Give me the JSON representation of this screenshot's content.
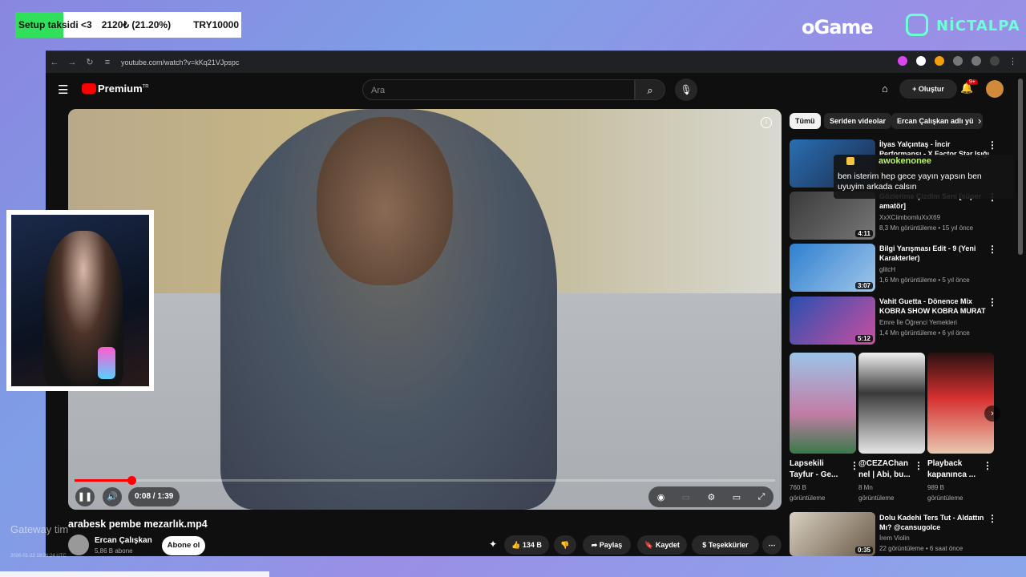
{
  "overlay": {
    "goal_title": "Setup taksidi <3",
    "goal_amount": "2120₺ (21.20%)",
    "goal_target": "TRY10000",
    "goal_progress": 0.212,
    "brand_left": "oGame",
    "brand_right": "NİCTALPA",
    "gateway_text": "Gateway tim",
    "gateway_date": "2026-01-22 18:26:24 UTC"
  },
  "browser": {
    "url": "youtube.com/watch?v=kKq21VJpspc"
  },
  "youtube": {
    "logo": "Premium",
    "logo_sup": "TR",
    "search_placeholder": "Ara",
    "create_label": "Oluştur",
    "notif_badge": "9+"
  },
  "player": {
    "time": "0:08 / 1:39",
    "progress": 0.081
  },
  "video": {
    "title": "arabesk pembe mezarlık.mp4",
    "channel": "Ercan Çalışkan",
    "subscribers": "5,86 B abone",
    "subscribe_label": "Abone ol",
    "likes": "134 B",
    "share_label": "Paylaş",
    "save_label": "Kaydet",
    "thanks_label": "Teşekkürler"
  },
  "sidebar": {
    "chips": [
      "Tümü",
      "Seriden videolar",
      "Ercan Çalışkan adlı yü"
    ],
    "related": [
      {
        "title": "İlyas Yalçıntaş - İncir Performansı - X Factor Star Işığı",
        "channel": "",
        "meta": "",
        "duration": ""
      },
      {
        "title": "Gözlerime Çizdim Seni [süper amatör]",
        "channel": "XxXCiimbomluXxX69",
        "meta": "8,3 Mn görüntüleme • 15 yıl önce",
        "duration": "4:11"
      },
      {
        "title": "Bilgi Yarışması Edit - 9 (Yeni Karakterler)",
        "channel": "glitcH",
        "meta": "1,6 Mn görüntüleme • 5 yıl önce",
        "duration": "3:07"
      },
      {
        "title": "Vahit Guetta - Dönence Mix KOBRA SHOW KOBRA MURAT",
        "channel": "Emre İle Öğrenci Yemekleri",
        "meta": "1,4 Mn görüntüleme • 6 yıl önce",
        "duration": "5:12"
      }
    ],
    "shorts": [
      {
        "title1": "Lapsekili",
        "title2": "Tayfur - Ge...",
        "views1": "760 B",
        "views2": "görüntüleme"
      },
      {
        "title1": "@CEZAChan",
        "title2": "nel | Abi, bu...",
        "views1": "8 Mn",
        "views2": "görüntüleme"
      },
      {
        "title1": "Playback",
        "title2": "kapanınca ...",
        "views1": "989 B",
        "views2": "görüntüleme"
      }
    ],
    "last": {
      "title": "Dolu Kadehi Ters Tut - Aldattın Mı? @cansugolce",
      "channel": "İrem Violin",
      "meta": "22 görüntüleme • 6 saat önce",
      "duration": "0:35"
    }
  },
  "chat": {
    "user": "awokenonee",
    "message": "ben isterim hep gece yayın yapsın ben uyuyim arkada calsın"
  },
  "colors": {
    "accent": "#ff0000",
    "goal_fill": "#31e05a",
    "chat_user": "#b7f36a"
  }
}
